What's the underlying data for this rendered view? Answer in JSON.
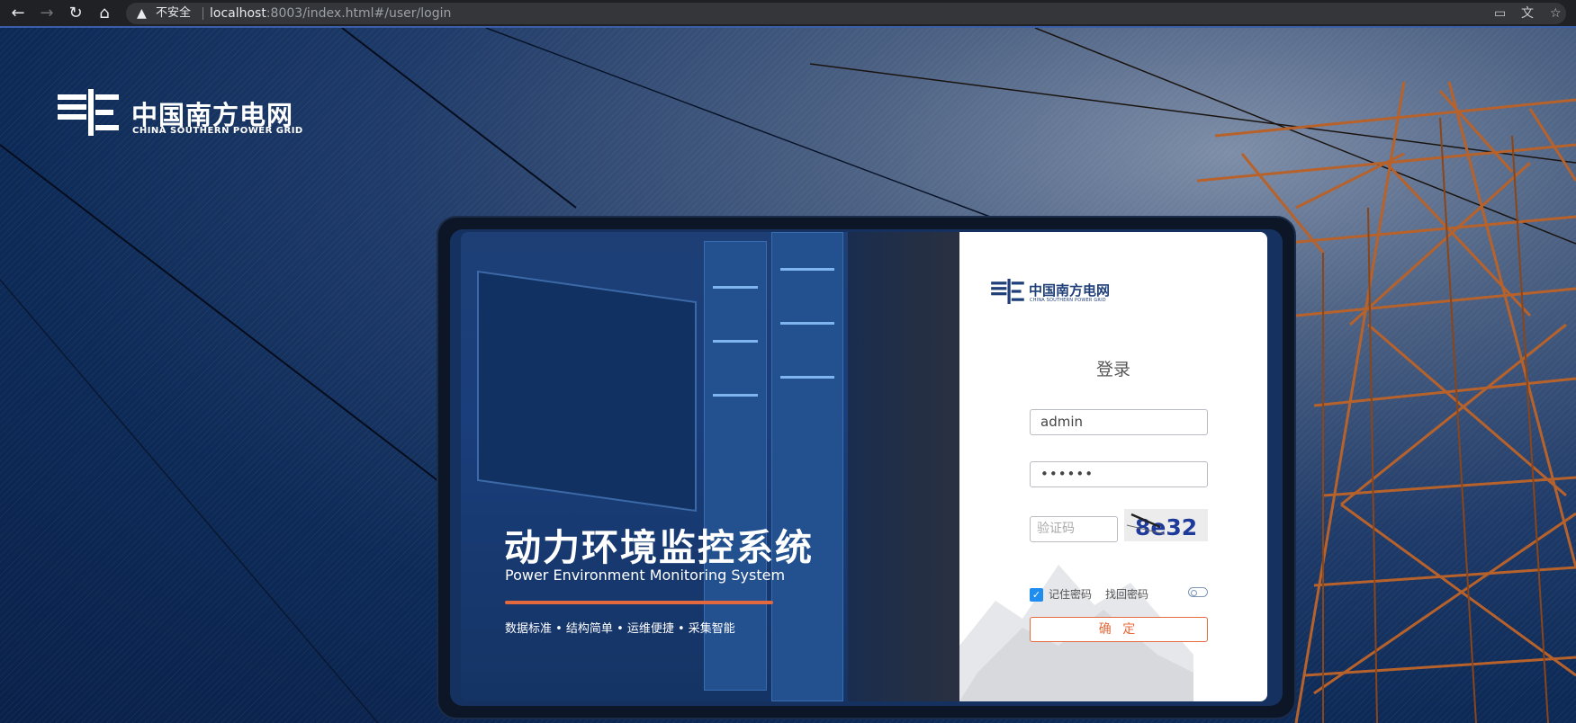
{
  "browser": {
    "back_icon": "←",
    "forward_icon": "→",
    "reload_icon": "↻",
    "home_icon": "⌂",
    "security_label": "不安全",
    "url_host": "localhost",
    "url_rest": ":8003/index.html#/user/login",
    "star_icon": "☆"
  },
  "brand": {
    "name_cn": "中国南方电网",
    "name_en": "CHINA SOUTHERN POWER GRID"
  },
  "hero": {
    "title_cn": "动力环境监控系统",
    "title_en": "Power Environment Monitoring System",
    "tagline": "数据标准 • 结构简单 • 运维便捷 • 采集智能"
  },
  "login": {
    "logo_cn": "中国南方电网",
    "logo_en": "CHINA SOUTHERN POWER GRID",
    "title": "登录",
    "username_value": "admin",
    "password_value": "••••••",
    "captcha_placeholder": "验证码",
    "captcha_text": "8e32",
    "remember_label": "记住密码",
    "remember_checked": "✓",
    "recover_label": "找回密码",
    "confirm_label": "确 定"
  },
  "colors": {
    "accent_orange": "#e56b3c",
    "brand_blue": "#1f3f78",
    "checkbox_blue": "#1f8cf0"
  }
}
